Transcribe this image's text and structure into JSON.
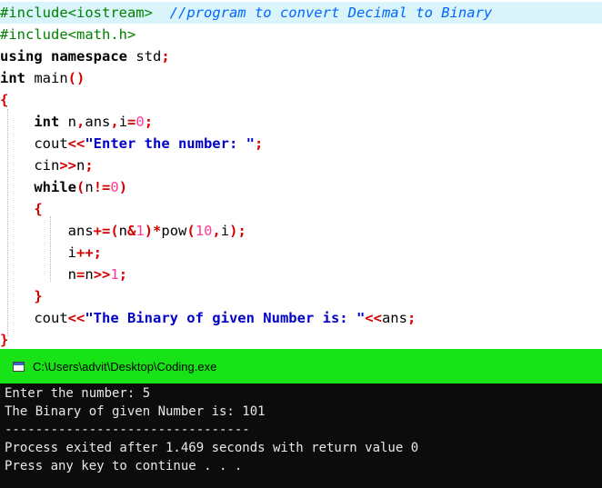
{
  "editor": {
    "line1": {
      "include": "#include<iostream>",
      "comment": "//program to convert Decimal to Binary"
    },
    "line2": {
      "include": "#include<math.h>"
    },
    "line3": {
      "kw1": "using",
      "kw2": "namespace",
      "id": "std",
      "semi": ";"
    },
    "line4": {
      "kw": "int",
      "id": "main",
      "parens": "()"
    },
    "line5": {
      "brace": "{"
    },
    "line6": {
      "kw": "int",
      "vars": "n",
      "c1": ",",
      "v2": "ans",
      "c2": ",",
      "v3": "i",
      "eq": "=",
      "zero": "0",
      "semi": ";"
    },
    "line7": {
      "id": "cout",
      "op": "<<",
      "str": "\"Enter the number: \"",
      "semi": ";"
    },
    "line8": {
      "id": "cin",
      "op": ">>",
      "var": "n",
      "semi": ";"
    },
    "line9": {
      "kw": "while",
      "lp": "(",
      "var": "n",
      "op": "!=",
      "zero": "0",
      "rp": ")"
    },
    "line10": {
      "brace": "{"
    },
    "line11": {
      "a": "ans",
      "op1": "+=",
      "lp": "(",
      "n": "n",
      "amp": "&",
      "one": "1",
      "rp": ")",
      "star": "*",
      "pow": "pow",
      "lp2": "(",
      "ten": "10",
      "comma": ",",
      "i": "i",
      "rp2": ")",
      "semi": ";"
    },
    "line12": {
      "i": "i",
      "op": "++",
      "semi": ";"
    },
    "line13": {
      "n1": "n",
      "eq": "=",
      "n2": "n",
      "op": ">>",
      "one": "1",
      "semi": ";"
    },
    "line14": {
      "brace": "}"
    },
    "line15": {
      "id": "cout",
      "op1": "<<",
      "str": "\"The Binary of given Number is: \"",
      "op2": "<<",
      "var": "ans",
      "semi": ";"
    },
    "line16": {
      "brace": "}"
    }
  },
  "console": {
    "title": "C:\\Users\\advit\\Desktop\\Coding.exe",
    "lines": [
      "Enter the number: 5",
      "The Binary of given Number is: 101",
      "--------------------------------",
      "Process exited after 1.469 seconds with return value 0",
      "Press any key to continue . . ."
    ]
  },
  "colors": {
    "keyword": "#000000",
    "preprocessor": "#008000",
    "comment": "#0066ff",
    "string": "#0000c8",
    "operator": "#d40000",
    "number": "#ff3b96",
    "console_titlebar": "#17e317",
    "console_bg": "#0c0c0c"
  }
}
